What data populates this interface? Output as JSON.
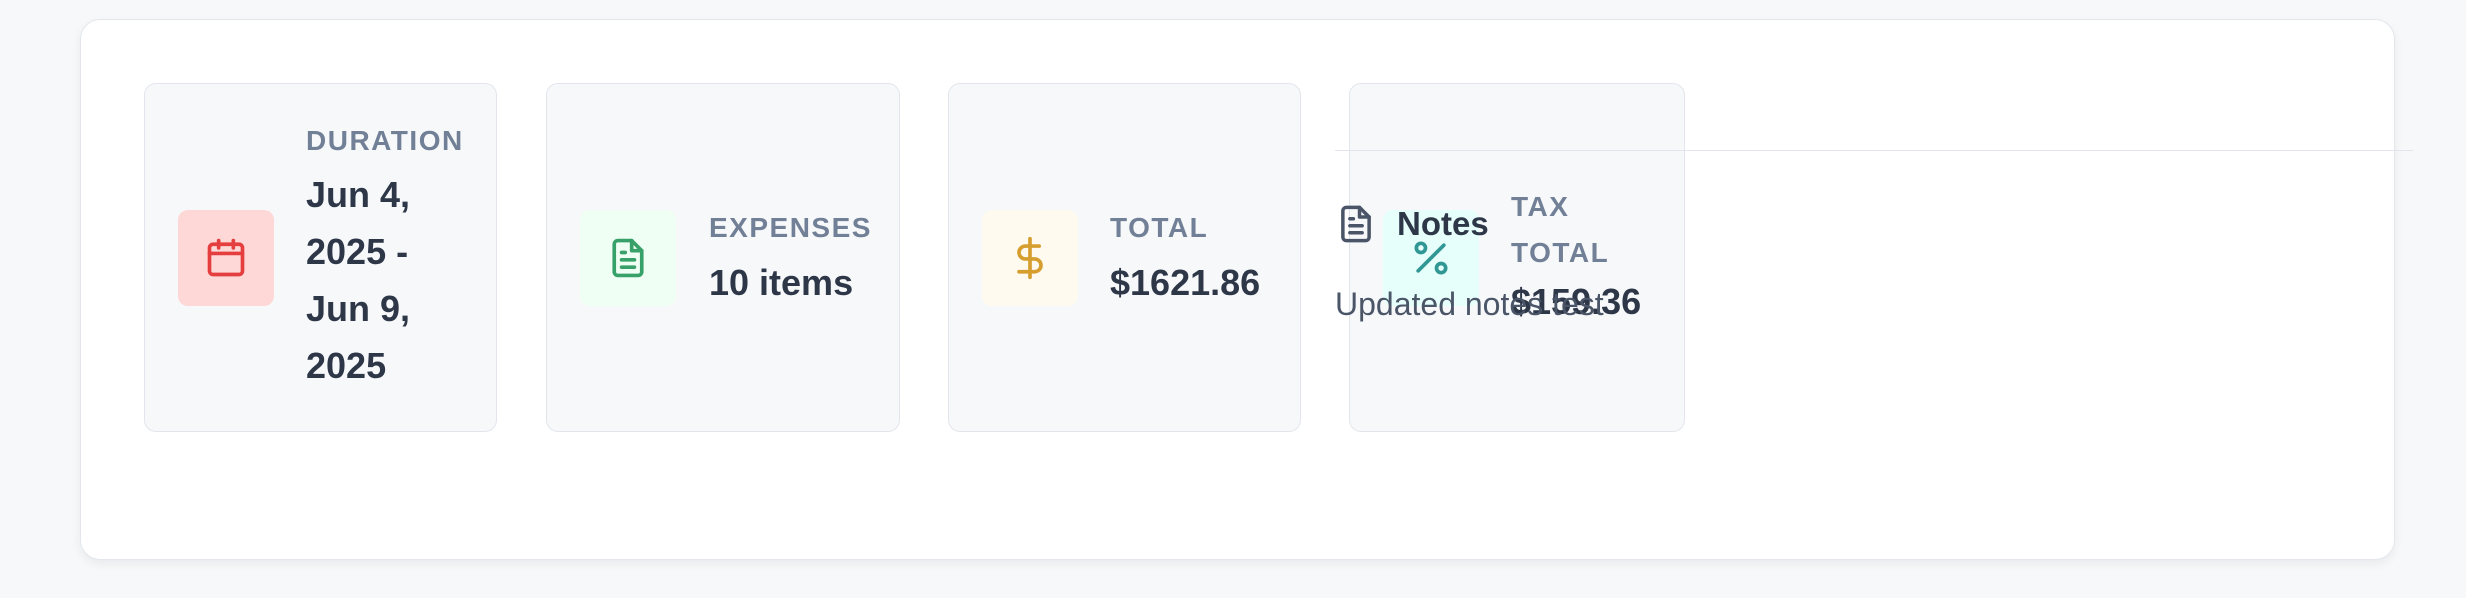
{
  "summary": {
    "cards": [
      {
        "label": "DURATION",
        "value": "Jun 4, 2025 - Jun 9, 2025",
        "icon": "calendar-icon",
        "icon_bg": "#fed7d7",
        "icon_color": "#e53e3e"
      },
      {
        "label": "EXPENSES",
        "value": "10 items",
        "icon": "document-icon",
        "icon_bg": "#f0fff4",
        "icon_color": "#38a169"
      },
      {
        "label": "TOTAL",
        "value": "$1621.86",
        "icon": "dollar-icon",
        "icon_bg": "#fffaf0",
        "icon_color": "#d69e2e"
      },
      {
        "label": "TAX TOTAL",
        "value": "$159.36",
        "icon": "percent-icon",
        "icon_bg": "#e6fffa",
        "icon_color": "#319795"
      }
    ]
  },
  "notes": {
    "title": "Notes",
    "text": "Updated notes test",
    "icon": "document-icon"
  }
}
